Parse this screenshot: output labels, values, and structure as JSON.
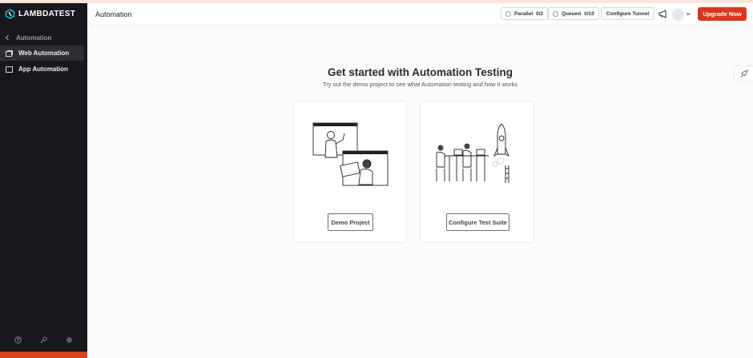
{
  "brand": {
    "name": "LAMBDATEST",
    "accent": "#d9381e"
  },
  "sidebar": {
    "back_label": "Automation",
    "items": [
      {
        "label": "Web Automation",
        "icon": "browser-window-icon",
        "active": true
      },
      {
        "label": "App Automation",
        "icon": "mobile-app-icon",
        "active": false
      }
    ],
    "bottom_icons": [
      "help-icon",
      "key-icon",
      "settings-icon"
    ]
  },
  "header": {
    "title": "Automation",
    "parallel_label": "Parallel",
    "parallel_value": "0/2",
    "queued_label": "Queued",
    "queued_value": "0/10",
    "tunnel_label": "Configure Tunnel",
    "upgrade_label": "Upgrade Now"
  },
  "main": {
    "title": "Get started with Automation Testing",
    "subtitle": "Try out the demo project to see what Automation testing and how it works",
    "cards": [
      {
        "button_label": "Demo Project"
      },
      {
        "button_label": "Configure Test Suite"
      }
    ]
  }
}
